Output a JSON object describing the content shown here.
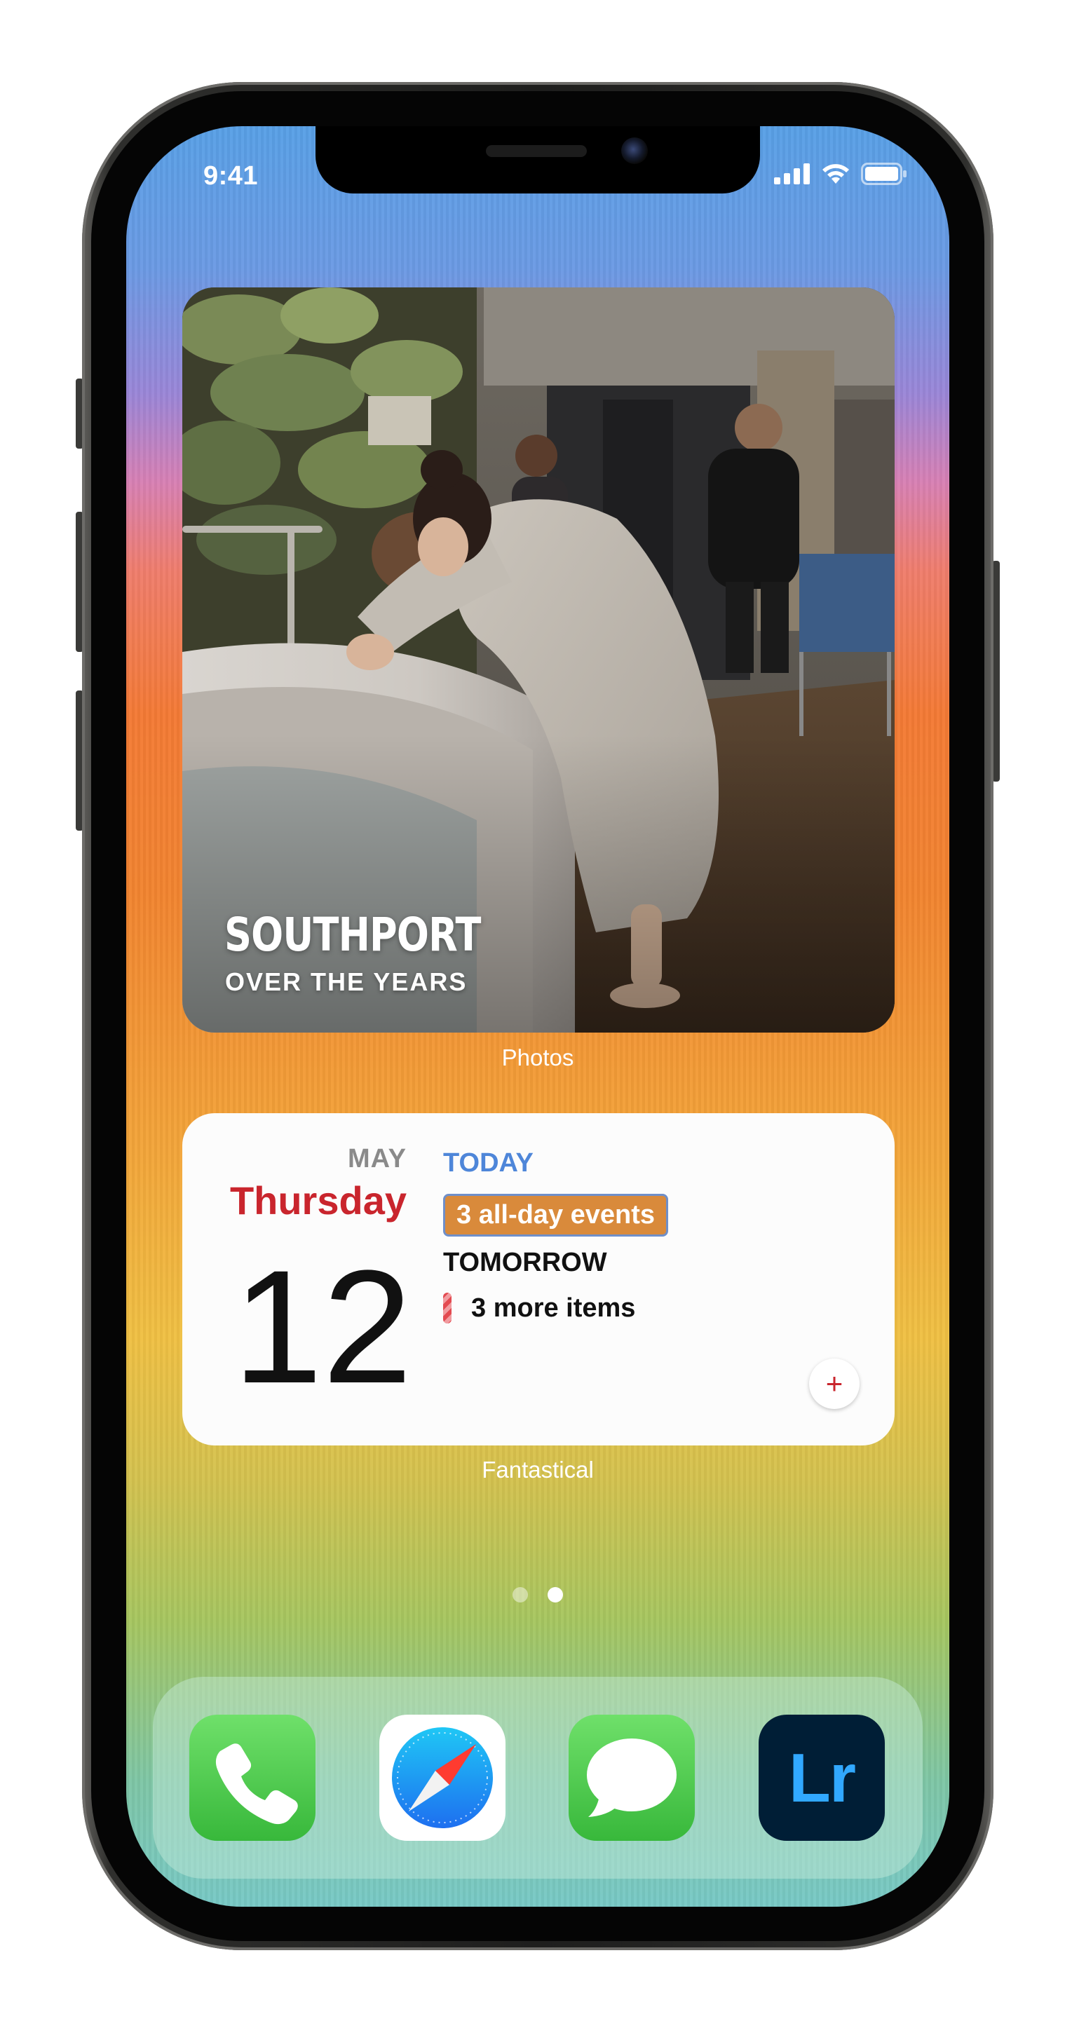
{
  "status_bar": {
    "time": "9:41",
    "icons": [
      "cellular-signal-icon",
      "wifi-icon",
      "battery-icon"
    ]
  },
  "photos_widget": {
    "title": "SOUTHPORT",
    "subtitle": "OVER THE YEARS",
    "caption": "Photos"
  },
  "fantastical_widget": {
    "month": "MAY",
    "weekday": "Thursday",
    "day": "12",
    "today_label": "TODAY",
    "today_event": "3 all-day events",
    "tomorrow_label": "TOMORROW",
    "tomorrow_items": "3 more items",
    "add_button_label": "+",
    "caption": "Fantastical",
    "colors": {
      "weekday": "#c9252d",
      "today": "#4e86d9",
      "event_bg": "#d98a3b"
    }
  },
  "page_indicator": {
    "count": 2,
    "active_index": 1
  },
  "dock": {
    "apps": [
      {
        "name": "Phone",
        "icon": "phone-icon"
      },
      {
        "name": "Safari",
        "icon": "safari-compass-icon"
      },
      {
        "name": "Messages",
        "icon": "message-bubble-icon"
      },
      {
        "name": "Lightroom",
        "icon": "lightroom-icon",
        "label": "Lr"
      }
    ]
  }
}
